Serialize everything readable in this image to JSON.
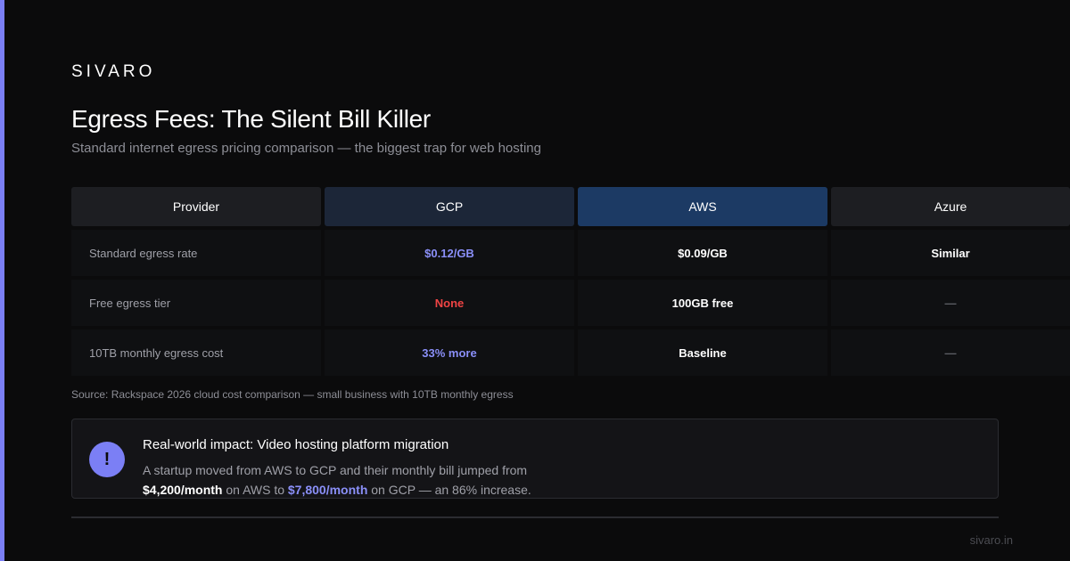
{
  "brand": "SIVARO",
  "title": "Egress Fees: The Silent Bill Killer",
  "subtitle": "Standard internet egress pricing comparison — the biggest trap for web hosting",
  "colors": {
    "accent": "#7b7ff5",
    "accent_text": "#8a8ff8",
    "danger": "#ef4444",
    "aws_header": "#1c3a64",
    "gcp_header": "#1c2638"
  },
  "table": {
    "headers": [
      "Provider",
      "GCP",
      "AWS",
      "Azure"
    ],
    "rows": [
      {
        "label": "Standard egress rate",
        "gcp": "$0.12/GB",
        "aws": "$0.09/GB",
        "azure": "Similar"
      },
      {
        "label": "Free egress tier",
        "gcp": "None",
        "aws": "100GB free",
        "azure": "—"
      },
      {
        "label": "10TB monthly egress cost",
        "gcp": "33% more",
        "aws": "Baseline",
        "azure": "—"
      }
    ]
  },
  "source": "Source: Rackspace 2026 cloud cost comparison — small business with 10TB monthly egress",
  "callout": {
    "icon": "alert-icon",
    "icon_glyph": "!",
    "title": "Real-world impact: Video hosting platform migration",
    "line1": "A startup moved from AWS to GCP and their monthly bill jumped from",
    "aws_amount": "$4,200/month",
    "mid": " on AWS to ",
    "gcp_amount": "$7,800/month",
    "end": " on GCP — an 86% increase."
  },
  "footer": {
    "domain": "sivaro.in"
  }
}
